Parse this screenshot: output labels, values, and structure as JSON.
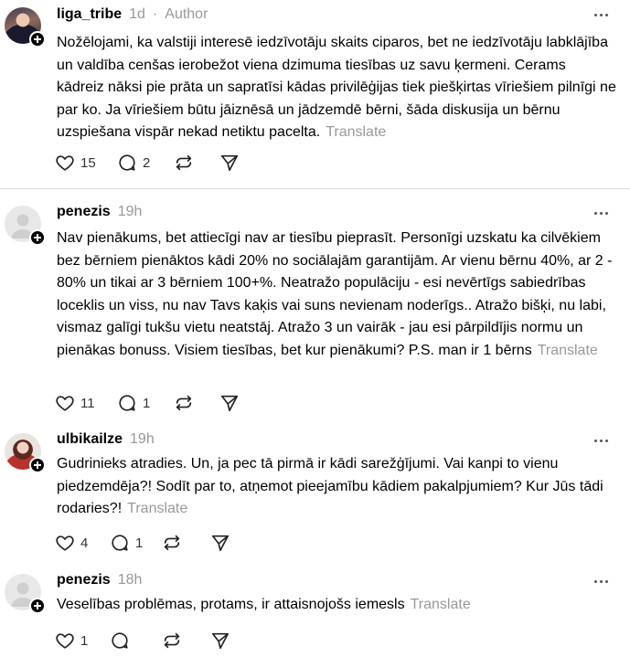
{
  "posts": [
    {
      "username": "liga_tribe",
      "time": "1d",
      "separator": "·",
      "badge": "Author",
      "text": "Nožēlojami, ka valstiji interesē iedzīvotāju skaits ciparos, bet ne iedzīvotāju labklājība un valdība cenšas ierobežot viena dzimuma tiesības uz savu ķermeni. Cerams kādreiz nāksi pie prāta un sapratīsi kādas privilēģijas tiek piešķirtas vīriešiem pilnīgi ne par ko. Ja vīriešiem būtu jāiznēsā un jādzemdē bērni, šāda diskusija un bērnu uzspiešana vispār nekad netiktu pacelta.",
      "translate": "Translate",
      "likes": "15",
      "replies": "2",
      "avatar_icon": "user-avatar"
    },
    {
      "username": "penezis",
      "time": "19h",
      "text": "Nav pienākums, bet attiecīgi nav ar tiesību pieprasīt. Personīgi uzskatu ka cilvēkiem bez bērniem pienāktos kādi 20% no sociālajām garantijām. Ar vienu bērnu 40%, ar 2 - 80% un tikai ar 3 bērniem 100+%. Neatražo populāciju - esi nevērtīgs sabiedrības loceklis un viss, nu nav Tavs kaķis vai suns nevienam noderīgs.. Atražo bišķi, nu labi, vismaz galīgi tukšu vietu neatstāj. Atražo 3 un vairāk - jau esi pārpildījis normu un pienākas bonuss. Visiem tiesības, bet kur pienākumi? P.S. man ir 1 bērns",
      "translate": "Translate",
      "likes": "11",
      "replies": "1",
      "avatar_icon": "default-avatar"
    },
    {
      "username": "ulbikailze",
      "time": "19h",
      "text": "Gudrinieks atradies. Un, ja pec tā pirmā ir kādi sarežģījumi. Vai kanpi to vienu piedzemdēja?! Sodīt par to, atņemot pieejamību kādiem pakalpjumiem? Kur Jūs tādi rodaries?!",
      "translate": "Translate",
      "likes": "4",
      "replies": "1",
      "avatar_icon": "user-avatar"
    },
    {
      "username": "penezis",
      "time": "18h",
      "text": "Veselības problēmas, protams, ir attaisnojošs iemesls",
      "translate": "Translate",
      "likes": "1",
      "replies": "",
      "avatar_icon": "default-avatar"
    }
  ],
  "colors": {
    "muted": "#999999",
    "divider": "#dcdcdc",
    "text": "#000000"
  }
}
